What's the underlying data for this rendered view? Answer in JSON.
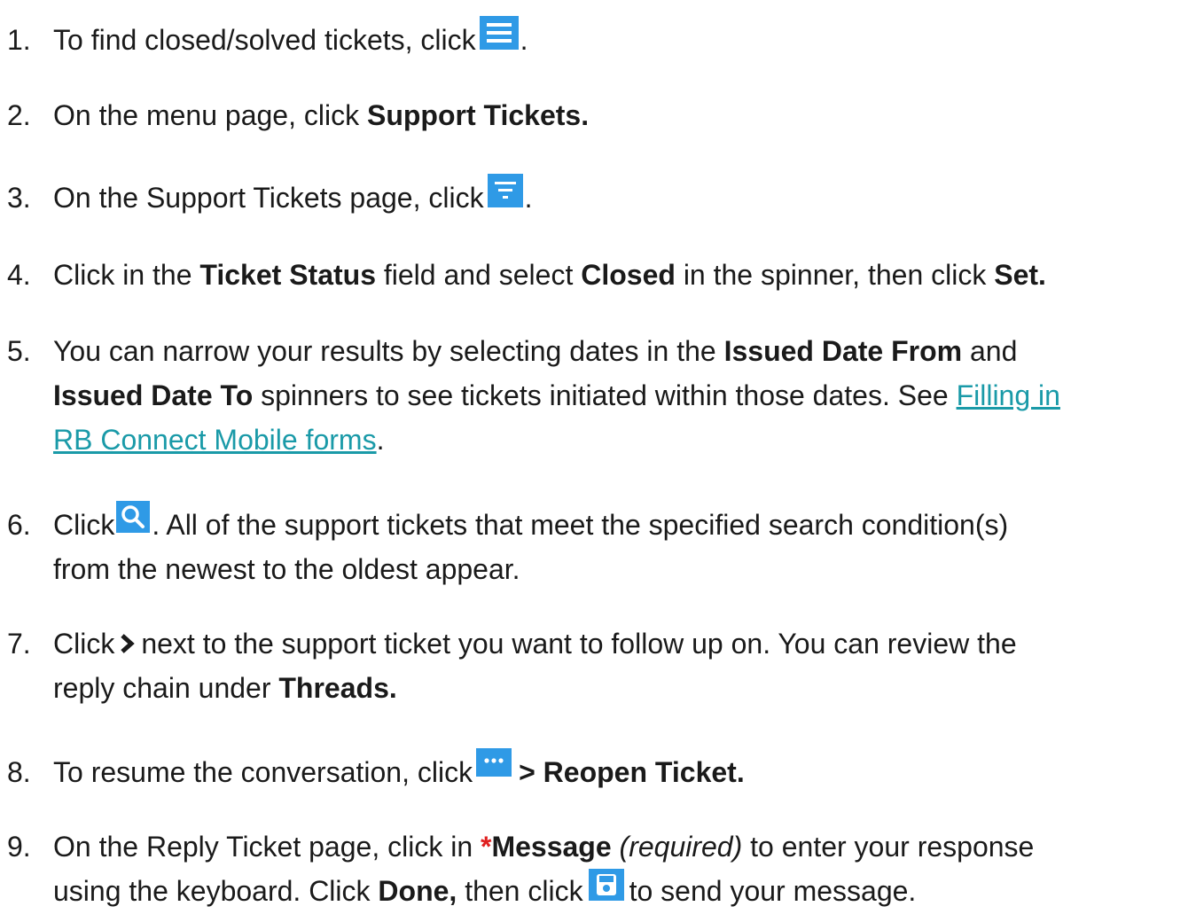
{
  "steps": [
    {
      "num": "1.",
      "parts": {
        "a": "To find closed/solved tickets, click",
        "b": "."
      },
      "icon": "menu-icon"
    },
    {
      "num": "2.",
      "parts": {
        "a": "On the menu page, click ",
        "b": "Support Tickets."
      }
    },
    {
      "num": "3.",
      "parts": {
        "a": "On the Support Tickets page, click",
        "b": "."
      },
      "icon": "filter-icon"
    },
    {
      "num": "4.",
      "parts": {
        "a": "Click in the ",
        "b": "Ticket Status",
        "c": " field and select ",
        "d": "Closed",
        "e": " in the spinner, then click ",
        "f": "Set."
      }
    },
    {
      "num": "5.",
      "parts": {
        "a": "You can narrow your results by selecting dates in the ",
        "b": "Issued Date From",
        "c": " and",
        "d": "Issued Date To",
        "e": " spinners to see tickets initiated within those dates. See ",
        "f": "Filling in",
        "g": "RB Connect Mobile forms",
        "h": "."
      }
    },
    {
      "num": "6.",
      "parts": {
        "a": "Click",
        "b": ". All of the support tickets that meet the specified search condition(s)",
        "c": "from the newest to the oldest appear."
      },
      "icon": "search-icon"
    },
    {
      "num": "7.",
      "parts": {
        "a": "Click",
        "b": "next to the support ticket you want to follow up on. You can review the",
        "c": "reply chain under ",
        "d": "Threads."
      },
      "icon": "chevron-right-icon"
    },
    {
      "num": "8.",
      "parts": {
        "a": "To resume the conversation, click",
        "b": "> Reopen Ticket."
      },
      "icon": "more-icon"
    },
    {
      "num": "9.",
      "parts": {
        "a": "On the Reply Ticket page, click in ",
        "b": "*",
        "c": "Message",
        "d": "(required)",
        "e": " to enter your response",
        "f": "using the keyboard. Click ",
        "g": "Done,",
        "h": " then click",
        "i": "to send your message."
      },
      "icon": "save-icon"
    }
  ],
  "colors": {
    "icon_blue": "#2f9ae6",
    "link": "#1a9aa8",
    "required": "#e02020",
    "text": "#1a1a1a"
  }
}
